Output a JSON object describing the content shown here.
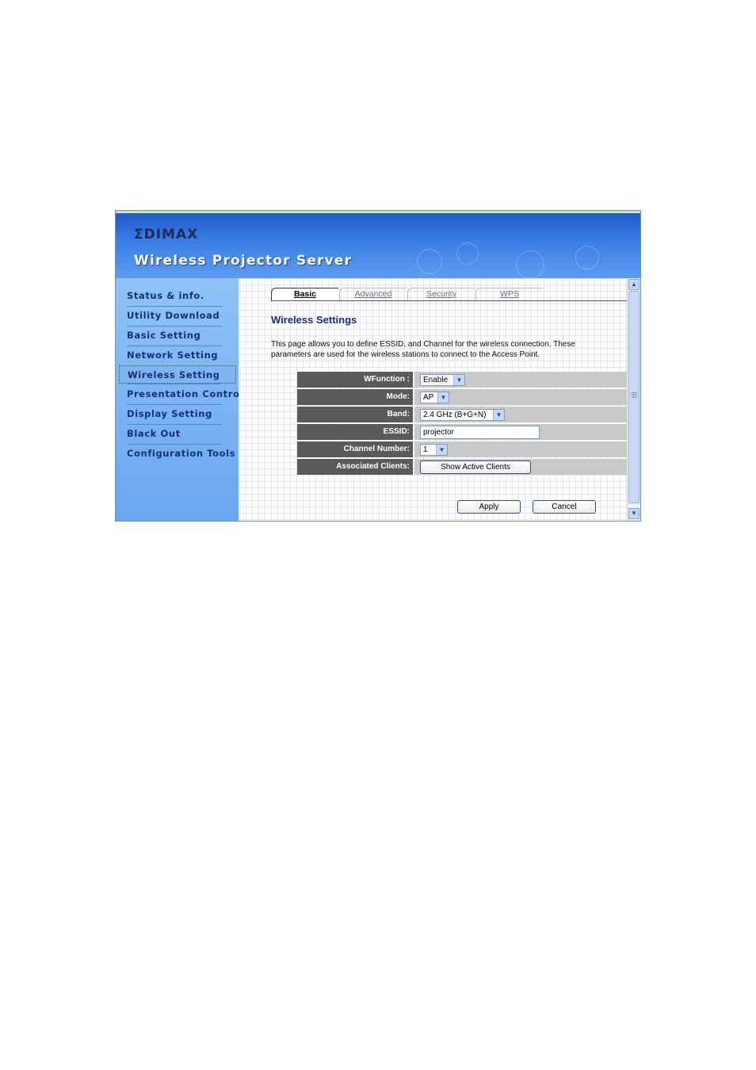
{
  "header": {
    "logo": "ΣDIMAX",
    "title": "Wireless Projector Server"
  },
  "sidebar": {
    "items": [
      {
        "label": "Status & info."
      },
      {
        "label": "Utility Download"
      },
      {
        "label": "Basic Setting"
      },
      {
        "label": "Network Setting"
      },
      {
        "label": "Wireless Setting",
        "active": true
      },
      {
        "label": "Presentation Control"
      },
      {
        "label": "Display Setting"
      },
      {
        "label": "Black Out"
      },
      {
        "label": "Configuration Tools"
      }
    ]
  },
  "tabs": [
    {
      "label": "Basic",
      "active": true
    },
    {
      "label": "Advanced"
    },
    {
      "label": "Security"
    },
    {
      "label": "WPS"
    }
  ],
  "main": {
    "title": "Wireless Settings",
    "description": "This page allows you to define ESSID, and Channel for the wireless connection. These parameters are used for the wireless stations to connect to the Access Point."
  },
  "form": {
    "wfunction": {
      "label": "WFunction :",
      "value": "Enable"
    },
    "mode": {
      "label": "Mode:",
      "value": "AP"
    },
    "band": {
      "label": "Band:",
      "value": "2.4 GHz (B+G+N)"
    },
    "essid": {
      "label": "ESSID:",
      "value": "projector"
    },
    "channel": {
      "label": "Channel Number:",
      "value": "1"
    },
    "clients": {
      "label": "Associated Clients:",
      "button": "Show Active Clients"
    }
  },
  "actions": {
    "apply": "Apply",
    "cancel": "Cancel"
  },
  "icons": {
    "dropdown": "chevron-down-icon",
    "scroll_up": "arrow-up-icon",
    "scroll_down": "arrow-down-icon"
  }
}
